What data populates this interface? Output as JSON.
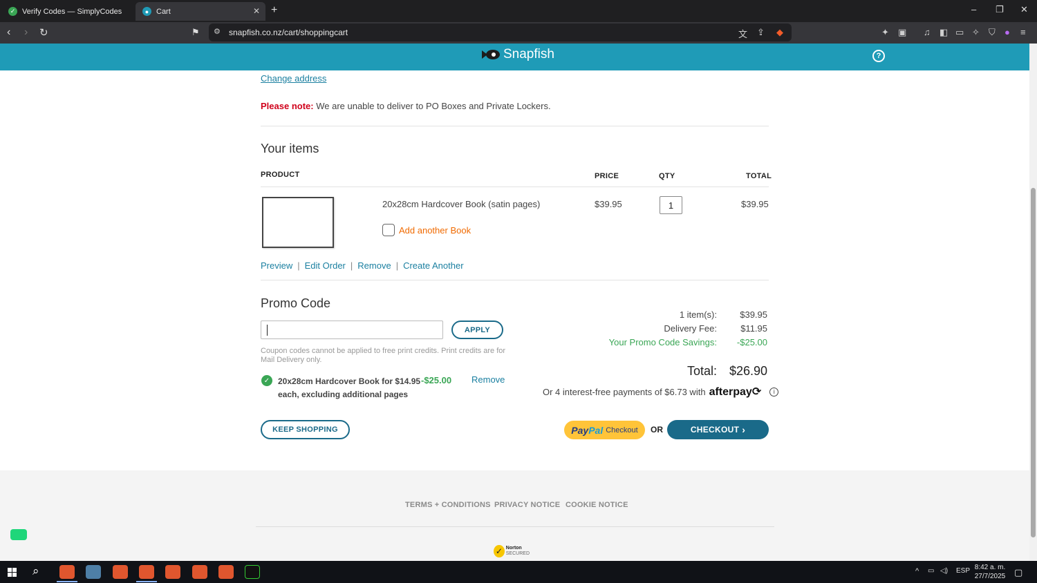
{
  "browser": {
    "tabs": [
      {
        "title": "Verify Codes — SimplyCodes",
        "active": false
      },
      {
        "title": "Cart",
        "active": true
      }
    ],
    "url": "snapfish.co.nz/cart/shoppingcart"
  },
  "header": {
    "brand": "Snapfish",
    "help_icon": "?"
  },
  "address": {
    "change_label": "Change address",
    "note_label": "Please note:",
    "note_text": " We are unable to deliver to PO Boxes and Private Lockers."
  },
  "items": {
    "title": "Your items",
    "columns": {
      "product": "PRODUCT",
      "price": "PRICE",
      "qty": "QTY",
      "total": "TOTAL"
    },
    "product": {
      "name": "20x28cm Hardcover Book (satin pages)",
      "price": "$39.95",
      "qty": "1",
      "total": "$39.95",
      "add_another": "Add another Book"
    },
    "actions": {
      "preview": "Preview",
      "edit": "Edit Order",
      "remove": "Remove",
      "create": "Create Another",
      "sep": "|"
    }
  },
  "promo": {
    "title": "Promo Code",
    "input_value": "",
    "apply_label": "APPLY",
    "coupon_note": "Coupon codes cannot be applied to free print credits. Print credits are for Mail Delivery only.",
    "applied_desc": "20x28cm Hardcover Book for $14.95 each, excluding additional pages",
    "applied_amount": "-$25.00",
    "remove_label": "Remove"
  },
  "summary": {
    "items_label": "1 item(s):",
    "items_value": "$39.95",
    "delivery_label": "Delivery Fee:",
    "delivery_value": "$11.95",
    "savings_label": "Your Promo Code Savings:",
    "savings_value": "-$25.00",
    "total_label": "Total:",
    "total_value": "$26.90",
    "afterpay_text": "Or 4 interest-free payments of $6.73 with",
    "afterpay_brand": "afterpay",
    "afterpay_icon": "⟳",
    "info_icon": "i"
  },
  "buttons": {
    "keep_shopping": "KEEP SHOPPING",
    "paypal_pay": "Pay",
    "paypal_pal": "Pal",
    "paypal_checkout": "Checkout",
    "or": "OR",
    "checkout": "CHECKOUT",
    "checkout_chevron": "›"
  },
  "footer": {
    "terms": "TERMS + CONDITIONS",
    "privacy": "PRIVACY NOTICE",
    "cookie": "COOKIE NOTICE",
    "norton_line1": "Norton",
    "norton_line2": "SECURED"
  },
  "taskbar": {
    "language": "ESP",
    "time": "8:42 a. m.",
    "date": "27/7/2025"
  },
  "colors": {
    "brand_teal": "#1f9bb7",
    "button_navy": "#1a6a89",
    "savings_green": "#3aa655",
    "alert_red": "#d0021b",
    "accent_orange": "#f06a00"
  }
}
